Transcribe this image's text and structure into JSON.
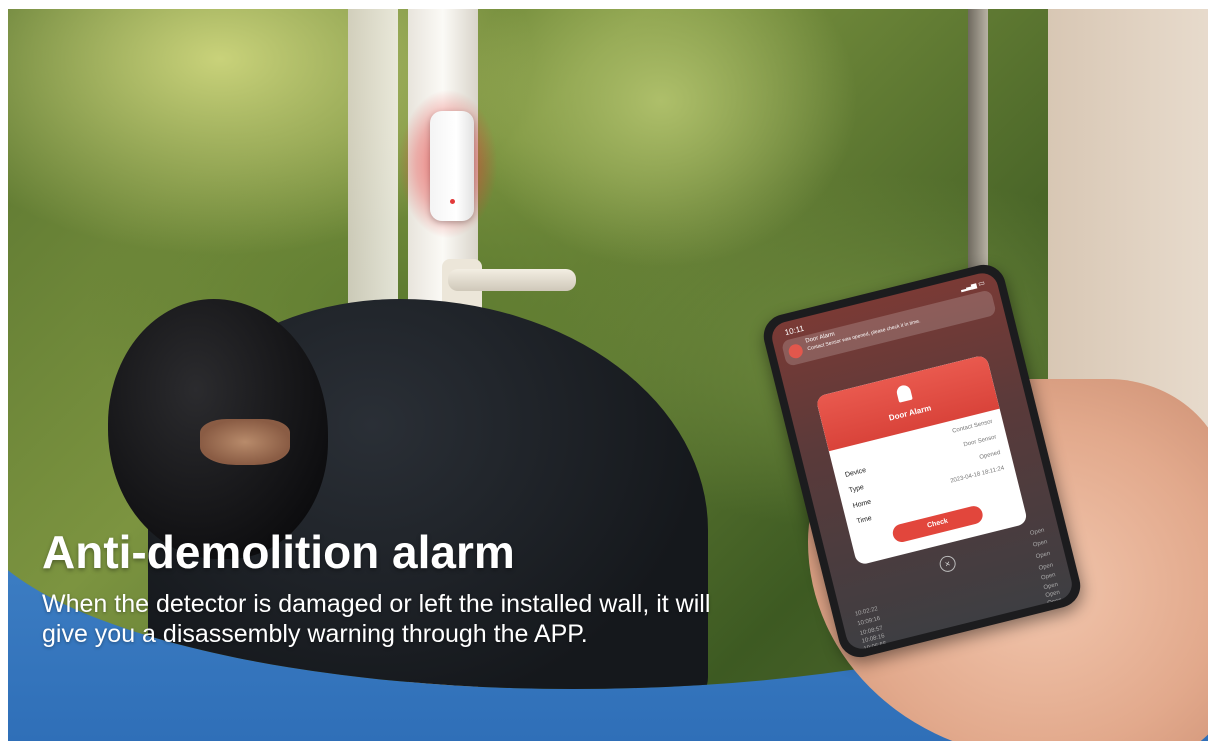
{
  "headline": "Anti-demolition alarm",
  "description": "When the detector is damaged or left the installed wall, it will give you a disassembly warning through the APP.",
  "phone": {
    "status_time": "10:11",
    "notification": {
      "title": "Door Alarm",
      "text": "Contact Sensor was opened, please check it in time."
    },
    "dialog": {
      "title": "Door Alarm",
      "rows": [
        {
          "label": "",
          "value": "Contact Sensor"
        },
        {
          "label": "Device",
          "value": "Door Sensor"
        },
        {
          "label": "Type",
          "value": "Opened"
        },
        {
          "label": "Home",
          "value": "2023-04-18 18:11:24"
        },
        {
          "label": "Time",
          "value": ""
        }
      ],
      "check_label": "Check"
    },
    "log": [
      {
        "time": "",
        "state": "Open"
      },
      {
        "time": "",
        "state": "Open"
      },
      {
        "time": "",
        "state": "Open"
      },
      {
        "time": "10:02:22",
        "state": "Open"
      },
      {
        "time": "10:09:16",
        "state": "Open"
      },
      {
        "time": "10:08:57",
        "state": "Open"
      },
      {
        "time": "10:08:16",
        "state": "Open"
      },
      {
        "time": "10:06:55",
        "state": "Open"
      }
    ]
  },
  "colors": {
    "banner_blue": "#2f6fb8",
    "alarm_red": "#e2463c",
    "text_white": "#ffffff"
  }
}
